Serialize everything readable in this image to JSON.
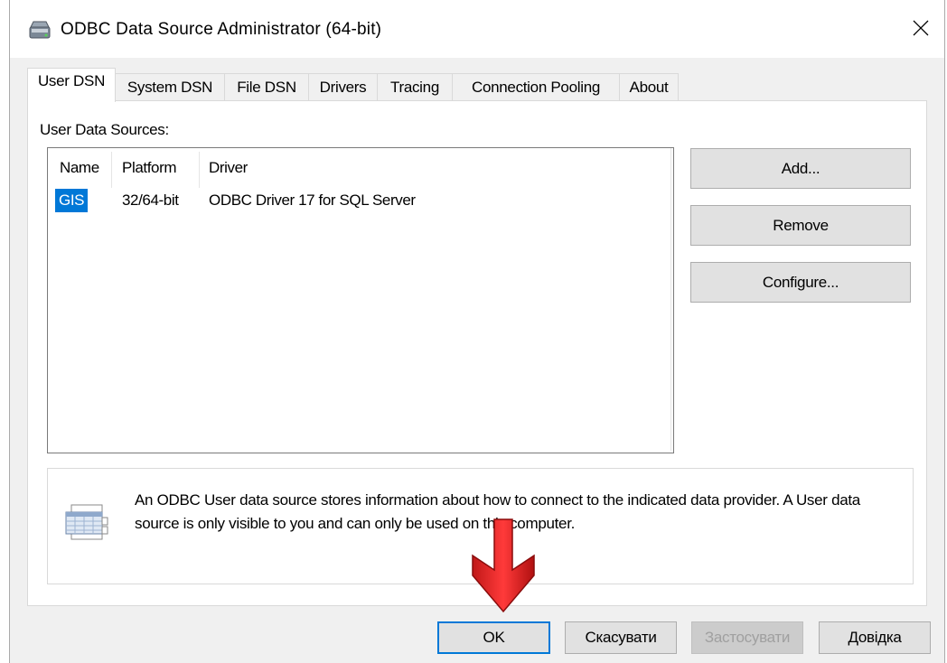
{
  "window": {
    "title": "ODBC Data Source Administrator (64-bit)",
    "close_glyph": "✕",
    "icon": "odbc-admin-icon"
  },
  "tabs": [
    {
      "label": "User DSN",
      "active": true
    },
    {
      "label": "System DSN",
      "active": false
    },
    {
      "label": "File DSN",
      "active": false
    },
    {
      "label": "Drivers",
      "active": false
    },
    {
      "label": "Tracing",
      "active": false
    },
    {
      "label": "Connection Pooling",
      "active": false
    },
    {
      "label": "About",
      "active": false
    }
  ],
  "section_label": "User Data Sources:",
  "table": {
    "headers": [
      "Name",
      "Platform",
      "Driver"
    ],
    "rows": [
      {
        "name": "GIS",
        "platform": "32/64-bit",
        "driver": "ODBC Driver 17 for SQL Server",
        "selected": true
      }
    ]
  },
  "side_buttons": {
    "add": "Add...",
    "remove": "Remove",
    "configure": "Configure..."
  },
  "info": {
    "icon": "data-source-info-icon",
    "text": "An ODBC User data source stores information about how to connect to the indicated data provider.  A User data source is only visible to you and can only be used on this computer."
  },
  "footer_buttons": {
    "ok": "OK",
    "cancel": "Скасувати",
    "apply": "Застосувати",
    "help": "Довідка"
  },
  "annotation": {
    "icon": "red-arrow-down-icon",
    "color": "#e02020"
  },
  "colors": {
    "selection": "#0078d7",
    "window_bg": "#f0f0f0",
    "button_bg": "#e1e1e1"
  }
}
